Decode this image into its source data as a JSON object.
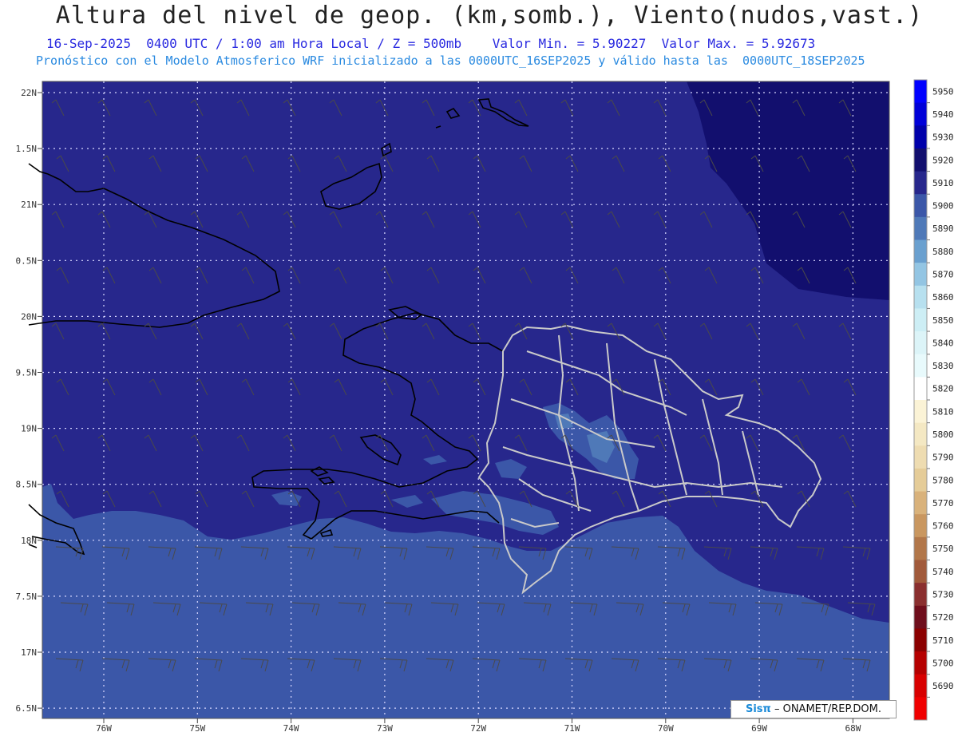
{
  "header": {
    "title": "Altura del nivel de geop. (km,somb.), Viento(nudos,vast.)",
    "line1": "16-Sep-2025  0400 UTC / 1:00 am Hora Local / Z = 500mb    Valor Min. = 5.90227  Valor Max. = 5.92673",
    "line2": "Pronóstico con el Modelo Atmosferico WRF inicializado a las 0000UTC_16SEP2025 y válido hasta las  0000UTC_18SEP2025"
  },
  "axes": {
    "lat_labels": [
      "22N",
      "1.5N",
      "21N",
      "0.5N",
      "20N",
      "9.5N",
      "19N",
      "8.5N",
      "18N",
      "7.5N",
      "17N",
      "6.5N"
    ],
    "lon_labels": [
      "76W",
      "75W",
      "74W",
      "73W",
      "72W",
      "71W",
      "70W",
      "69W",
      "68W"
    ]
  },
  "colorbar": {
    "labels": [
      "5950",
      "5940",
      "5930",
      "5920",
      "5910",
      "5900",
      "5890",
      "5880",
      "5870",
      "5860",
      "5850",
      "5840",
      "5830",
      "5820",
      "5810",
      "5800",
      "5790",
      "5780",
      "5770",
      "5760",
      "5750",
      "5740",
      "5730",
      "5720",
      "5710",
      "5700",
      "5690"
    ],
    "colors": [
      "#0000ff",
      "#0000d8",
      "#0000aa",
      "#120f6e",
      "#27278c",
      "#3b57a8",
      "#4f79b8",
      "#6aa0cf",
      "#93c5e3",
      "#b7e0ef",
      "#cdeef5",
      "#dcf4f8",
      "#e8fafc",
      "#ffffff",
      "#fbf3d6",
      "#f4e8c3",
      "#eedcb1",
      "#e5cc98",
      "#d9b27b",
      "#c99760",
      "#b2774a",
      "#a15a3b",
      "#8a2f2f",
      "#6f0e1c",
      "#8b0000",
      "#b50000",
      "#d80000",
      "#f00000"
    ]
  },
  "fields": {
    "base_color": "#27278c",
    "south_color": "#3b57a8",
    "northeast_color": "#120f6e",
    "patch_color": "#4f79b8"
  },
  "credit": {
    "brand": "Sisπ",
    "text": "– ONAMET/REP.DOM."
  }
}
